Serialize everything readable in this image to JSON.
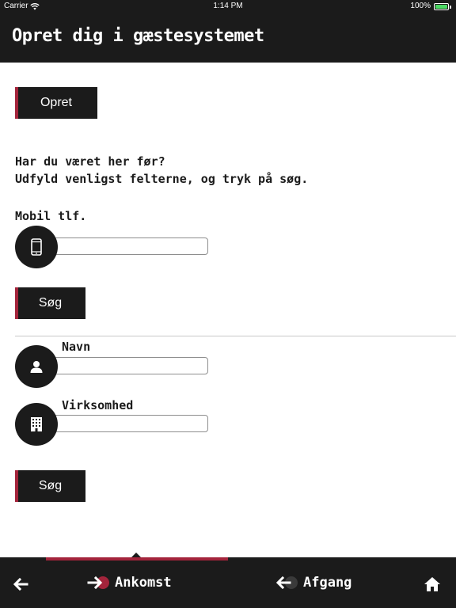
{
  "status_bar": {
    "carrier": "Carrier",
    "time": "1:14 PM",
    "battery": "100%"
  },
  "header": {
    "title": "Opret dig i gæstesystemet"
  },
  "actions": {
    "create_label": "Opret",
    "search_label": "Søg",
    "search2_label": "Søg"
  },
  "prompt": {
    "line1": "Har du været her før?",
    "line2": "Udfyld venligst felterne, og tryk på søg."
  },
  "form": {
    "mobile_label": "Mobil tlf.",
    "mobile_value": "",
    "name_label": "Navn",
    "name_value": "",
    "company_label": "Virksomhed",
    "company_value": ""
  },
  "bottom_nav": {
    "back_icon": "arrow-left-icon",
    "tabs": [
      {
        "label": "Ankomst",
        "icon": "arrival-icon",
        "active": true
      },
      {
        "label": "Afgang",
        "icon": "departure-icon",
        "active": false
      }
    ],
    "home_icon": "home-icon"
  },
  "colors": {
    "dark": "#1b1b1b",
    "accent": "#a3243b",
    "background": "#ffffff"
  }
}
